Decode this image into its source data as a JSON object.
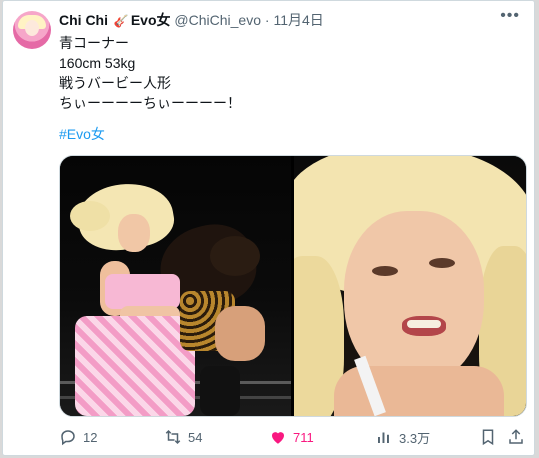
{
  "author": {
    "name_prefix": "Chi Chi",
    "name_suffix": "Evo女",
    "badge_icon": "electric-guitar-icon",
    "handle": "@ChiChi_evo",
    "separator": "·",
    "date": "11月4日"
  },
  "tweet": {
    "lines": [
      "青コーナー",
      "160cm 53kg",
      "戦うバービー人形",
      "ちぃーーーーちぃーーーー！"
    ],
    "hashtag": "#Evo女"
  },
  "media": {
    "count": 2,
    "images": [
      "wrestling-action-photo",
      "wrestler-closeup-photo"
    ]
  },
  "actions": {
    "replies": "12",
    "reposts": "54",
    "likes": "711",
    "views": "3.3万",
    "like_color": "#f91880"
  },
  "colors": {
    "link": "#1d9bf0",
    "text": "#0f1419",
    "muted": "#536471"
  }
}
